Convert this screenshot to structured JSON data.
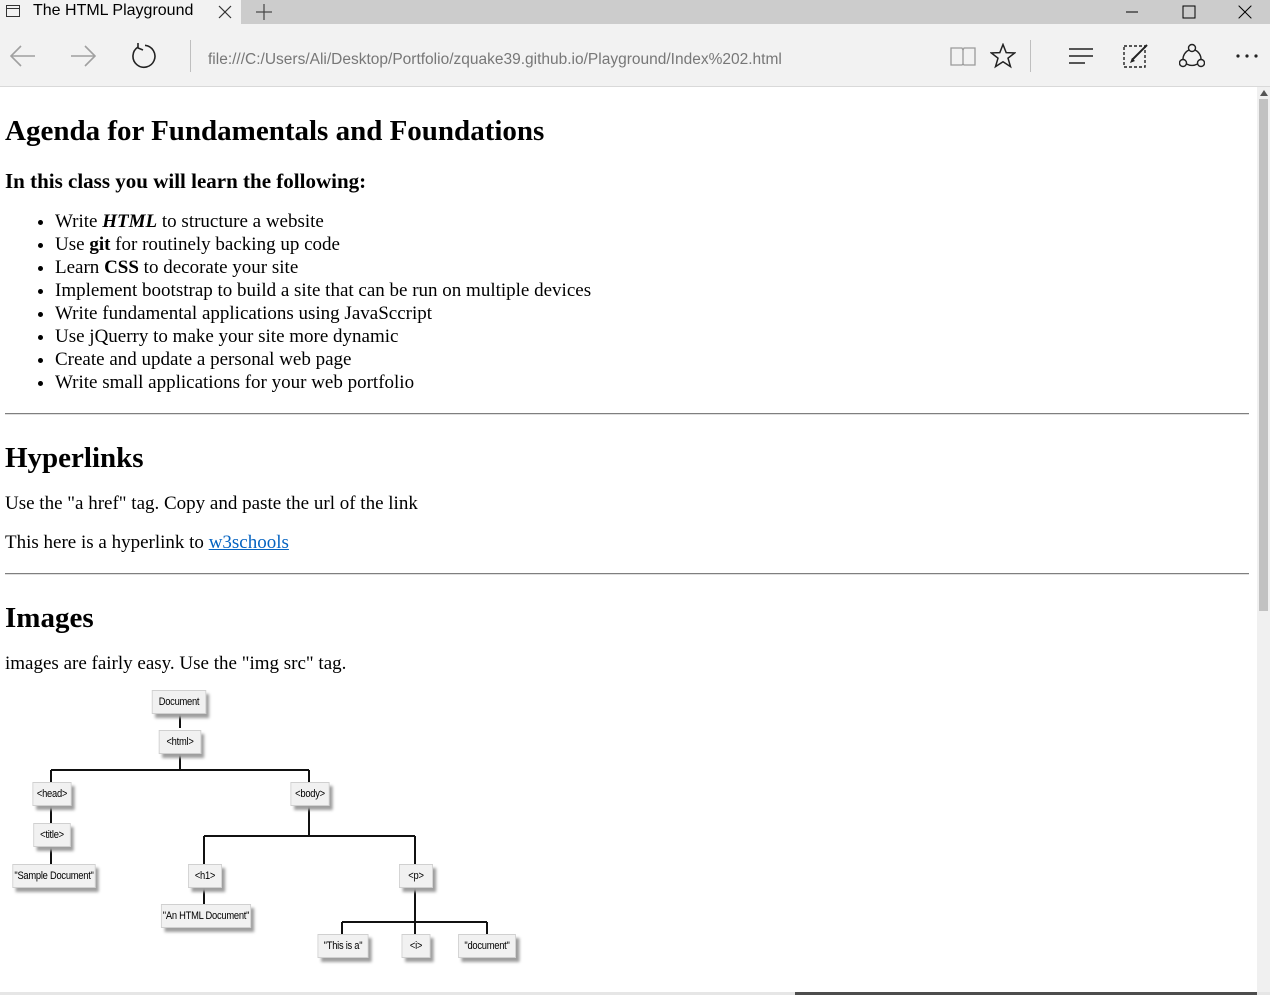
{
  "browser": {
    "tab_title": "The HTML Playground",
    "address": "file:///C:/Users/Ali/Desktop/Portfolio/zquake39.github.io/Playground/Index%202.html"
  },
  "page": {
    "agenda_heading": "Agenda for Fundamentals and Foundations",
    "learn_heading": "In this class you will learn the following:",
    "agenda_items": [
      {
        "prefix": "Write ",
        "emph": "HTML",
        "suffix": " to structure a website"
      },
      {
        "prefix": "Use ",
        "emph": "git",
        "suffix": " for routinely backing up code"
      },
      {
        "prefix": "Learn ",
        "emph": "CSS",
        "suffix": " to decorate your site"
      },
      {
        "prefix": "Implement bootstrap to build a site that can be run on multiple devices",
        "emph": "",
        "suffix": ""
      },
      {
        "prefix": "Write fundamental applications using JavaSccript",
        "emph": "",
        "suffix": ""
      },
      {
        "prefix": "Use jQuerry to make your site more dynamic",
        "emph": "",
        "suffix": ""
      },
      {
        "prefix": "Create and update a personal web page",
        "emph": "",
        "suffix": ""
      },
      {
        "prefix": "Write small applications for your web portfolio",
        "emph": "",
        "suffix": ""
      }
    ],
    "hyperlinks_heading": "Hyperlinks",
    "hyperlinks_text": "Use the \"a href\" tag. Copy and paste the url of the link",
    "hyperlink_sentence": "This here is a hyperlink to ",
    "hyperlink_label": "w3schools",
    "images_heading": "Images",
    "images_text": "images are fairly easy. Use the \"img src\" tag.",
    "dom_tree": {
      "document": "Document",
      "html": "<html>",
      "head": "<head>",
      "title": "<title>",
      "title_text": "\"Sample Document\"",
      "body": "<body>",
      "h1": "<h1>",
      "h1_text": "\"An HTML Document\"",
      "p": "<p>",
      "p_text1": "\"This is a\"",
      "i": "<i>",
      "p_text2": "\"document\""
    }
  }
}
